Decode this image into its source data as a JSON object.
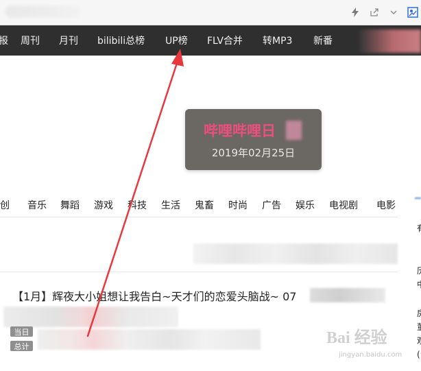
{
  "browser": {
    "icons": [
      "lightning-icon",
      "share-icon",
      "chevron-down-icon",
      "extension-icon"
    ]
  },
  "nav": {
    "items": [
      {
        "id": "rank",
        "label": "报"
      },
      {
        "id": "weekly",
        "label": "周刊"
      },
      {
        "id": "monthly",
        "label": "月刊"
      },
      {
        "id": "bilibili-rank",
        "label": "bilibili总榜"
      },
      {
        "id": "up-rank",
        "label": "UP榜"
      },
      {
        "id": "flv-merge",
        "label": "FLV合并"
      },
      {
        "id": "to-mp3",
        "label": "转MP3"
      },
      {
        "id": "new-anime",
        "label": "新番"
      }
    ]
  },
  "date_card": {
    "title": "哔哩哔哩日",
    "date": "2019年02月25日"
  },
  "categories": [
    "原创",
    "音乐",
    "舞蹈",
    "游戏",
    "科技",
    "生活",
    "鬼畜",
    "时尚",
    "广告",
    "娱乐",
    "电视剧",
    "电影"
  ],
  "video": {
    "title": "【1月】辉夜大小姐想让我告白~天才们的恋爱头脑战~ 07",
    "badges": [
      "当日",
      "总计"
    ]
  },
  "right_column": {
    "fragments": [
      "有",
      "历",
      "中",
      "房",
      "董",
      "观",
      "("
    ]
  },
  "watermark": {
    "text": "Bai 经验",
    "sub": "jingyan.baidu.com"
  },
  "colors": {
    "nav_bg": "#2f2f2f",
    "date_title": "#ec4f7c",
    "date_card_bg": "#6b6763",
    "arrow": "#e8383d",
    "badge_bg": "#8f8f8f"
  }
}
